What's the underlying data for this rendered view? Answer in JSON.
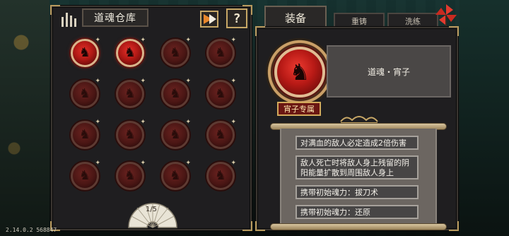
{
  "colors": {
    "panel": "#1f1e20",
    "gold_trim": "#c7a766",
    "medal_red": "#b81a16",
    "scroll_paper": "#6c6661"
  },
  "left_panel": {
    "header_icon": "torii-bars-icon",
    "title": "道魂仓库",
    "sort_icon": "sort-toggle-icon",
    "help_label": "?",
    "grid": {
      "columns": 4,
      "rows": 4,
      "slots": [
        {
          "state": "unlocked"
        },
        {
          "state": "unlocked"
        },
        {
          "state": "locked"
        },
        {
          "state": "locked"
        },
        {
          "state": "locked"
        },
        {
          "state": "locked"
        },
        {
          "state": "locked"
        },
        {
          "state": "locked"
        },
        {
          "state": "locked"
        },
        {
          "state": "locked"
        },
        {
          "state": "locked"
        },
        {
          "state": "locked"
        },
        {
          "state": "locked"
        },
        {
          "state": "locked"
        },
        {
          "state": "locked"
        },
        {
          "state": "locked"
        }
      ]
    },
    "pagination": {
      "label": "1/5",
      "icon": "folding-fan-icon"
    }
  },
  "right_panel": {
    "tabs": [
      {
        "label": "装备",
        "active": true
      },
      {
        "label": "重铸",
        "active": false
      },
      {
        "label": "洗练",
        "active": false
      }
    ],
    "corner_icon": "pinwheel-icon",
    "selected_soul": {
      "name": "道魂・宵子",
      "owner_tag": "宵子专属"
    },
    "skills": [
      "对满血的敌人必定造成2倍伤害",
      "敌人死亡时将敌人身上残留的阴阳能量扩散到周围敌人身上",
      "携带初始魂力：拔刀术",
      "携带初始魂力：还原"
    ]
  },
  "version_text": "2.14.0.2 568847"
}
